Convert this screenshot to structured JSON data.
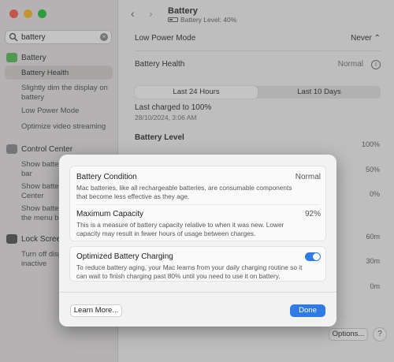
{
  "colors": {
    "accent": "#2f7ae5",
    "close": "#ff5f57",
    "minimize": "#febc2e",
    "zoom": "#28c840",
    "battery_group": "#5bc25b",
    "control_center": "#8e8e93",
    "lock_screen": "#5a5a5e"
  },
  "search": {
    "value": "battery"
  },
  "sidebar": {
    "groups": [
      {
        "label": "Battery",
        "items": [
          "Battery Health",
          "Slightly dim the display on battery",
          "Low Power Mode",
          "Optimize video streaming"
        ]
      },
      {
        "label": "Control Center",
        "items": [
          "Show battery in the menu bar",
          "Show battery in Control Center",
          "Show battery percentage in the menu bar"
        ]
      },
      {
        "label": "Lock Screen",
        "items": [
          "Turn off display when inactive"
        ]
      }
    ]
  },
  "header": {
    "title": "Battery",
    "subtitle": "Battery Level: 40%"
  },
  "settings": {
    "low_power_label": "Low Power Mode",
    "low_power_value": "Never",
    "health_label": "Battery Health",
    "health_value": "Normal",
    "tabs": [
      "Last 24 Hours",
      "Last 10 Days"
    ],
    "last_charged": "Last charged to 100%",
    "last_charged_date": "28/10/2024, 3:06 AM",
    "level_title": "Battery Level",
    "level_ticks": [
      "100%",
      "50%",
      "0%"
    ],
    "usage_ticks": [
      "60m",
      "30m",
      "0m"
    ],
    "options_label": "Options...",
    "help_label": "?"
  },
  "dialog": {
    "condition_title": "Battery Condition",
    "condition_value": "Normal",
    "condition_desc": "Mac batteries, like all rechargeable batteries, are consumable components that become less effective as they age.",
    "capacity_title": "Maximum Capacity",
    "capacity_value": "92%",
    "capacity_desc": "This is a measure of battery capacity relative to when it was new. Lower capacity may result in fewer hours of usage between charges.",
    "optimized_title": "Optimized Battery Charging",
    "optimized_on": true,
    "optimized_desc": "To reduce battery aging, your Mac learns from your daily charging routine so it can wait to finish charging past 80% until you need to use it on battery.",
    "learn_more_label": "Learn More...",
    "done_label": "Done"
  }
}
